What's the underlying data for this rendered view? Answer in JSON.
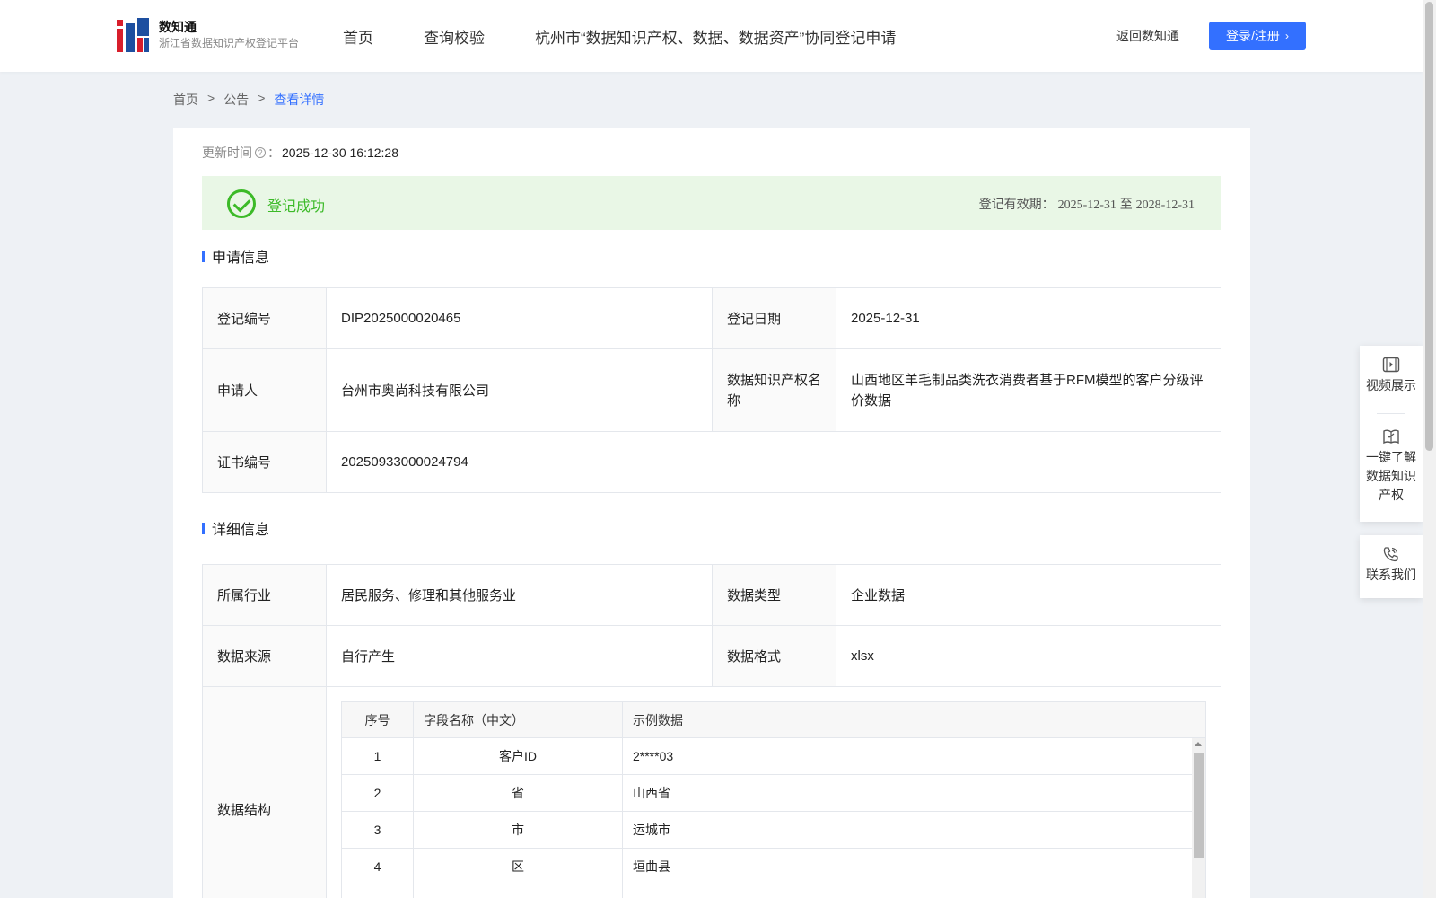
{
  "brand": {
    "name": "数知通",
    "subtitle": "浙江省数据知识产权登记平台"
  },
  "nav": [
    {
      "label": "首页"
    },
    {
      "label": "查询校验"
    },
    {
      "label": "杭州市“数据知识产权、数据、数据资产”协同登记申请"
    }
  ],
  "header": {
    "back_label": "返回数知通",
    "login_label": "登录/注册"
  },
  "breadcrumb": {
    "home": "首页",
    "sep": ">",
    "notice": "公告",
    "current": "查看详情"
  },
  "update": {
    "label": "更新时间",
    "suffix": "：",
    "value": "2025-12-30 16:12:28"
  },
  "status": {
    "text": "登记成功",
    "validity_label": "登记有效期：",
    "start": "2025-12-31",
    "to": "至",
    "end": "2028-12-31",
    "accent": "#3cba28"
  },
  "sections": {
    "apply": "申请信息",
    "detail": "详细信息"
  },
  "apply_info": {
    "reg_no_label": "登记编号",
    "reg_no": "DIP2025000020465",
    "reg_date_label": "登记日期",
    "reg_date": "2025-12-31",
    "applicant_label": "申请人",
    "applicant": "台州市奥尚科技有限公司",
    "ip_name_label": "数据知识产权名称",
    "ip_name": "山西地区羊毛制品类洗衣消费者基于RFM模型的客户分级评价数据",
    "cert_no_label": "证书编号",
    "cert_no": "20250933000024794"
  },
  "detail_info": {
    "industry_label": "所属行业",
    "industry": "居民服务、修理和其他服务业",
    "data_type_label": "数据类型",
    "data_type": "企业数据",
    "source_label": "数据来源",
    "source": "自行产生",
    "format_label": "数据格式",
    "format": "xlsx",
    "structure_label": "数据结构"
  },
  "structure": {
    "headers": [
      "序号",
      "字段名称（中文）",
      "示例数据"
    ],
    "rows": [
      [
        "1",
        "客户ID",
        "2****03"
      ],
      [
        "2",
        "省",
        "山西省"
      ],
      [
        "3",
        "市",
        "运城市"
      ],
      [
        "4",
        "区",
        "垣曲县"
      ]
    ]
  },
  "float_panel": {
    "video": "视频展示",
    "learn_line1": "一键了解",
    "learn_line2": "数据知识",
    "learn_line3": "产权",
    "contact": "联系我们"
  },
  "colors": {
    "primary": "#3370ff",
    "success_bg": "#e9f7e6"
  }
}
